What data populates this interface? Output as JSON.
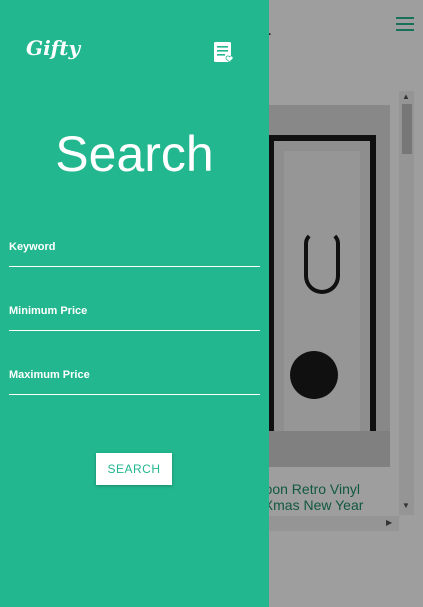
{
  "background": {
    "title_fragment": "..",
    "item_title_line1": "rtoon Retro Vinyl",
    "item_title_line2": "t Xmas New Year"
  },
  "drawer": {
    "logo_text": "Gifty",
    "heading": "Search",
    "fields": [
      {
        "label": "Keyword",
        "value": ""
      },
      {
        "label": "Minimum Price",
        "value": ""
      },
      {
        "label": "Maximum Price",
        "value": ""
      }
    ],
    "search_button": "SEARCH"
  },
  "colors": {
    "accent": "#22b78e",
    "overlay": "rgba(0,0,0,0.38)"
  },
  "icons": {
    "menu": "hamburger-icon",
    "wishlist": "list-heart-icon"
  }
}
